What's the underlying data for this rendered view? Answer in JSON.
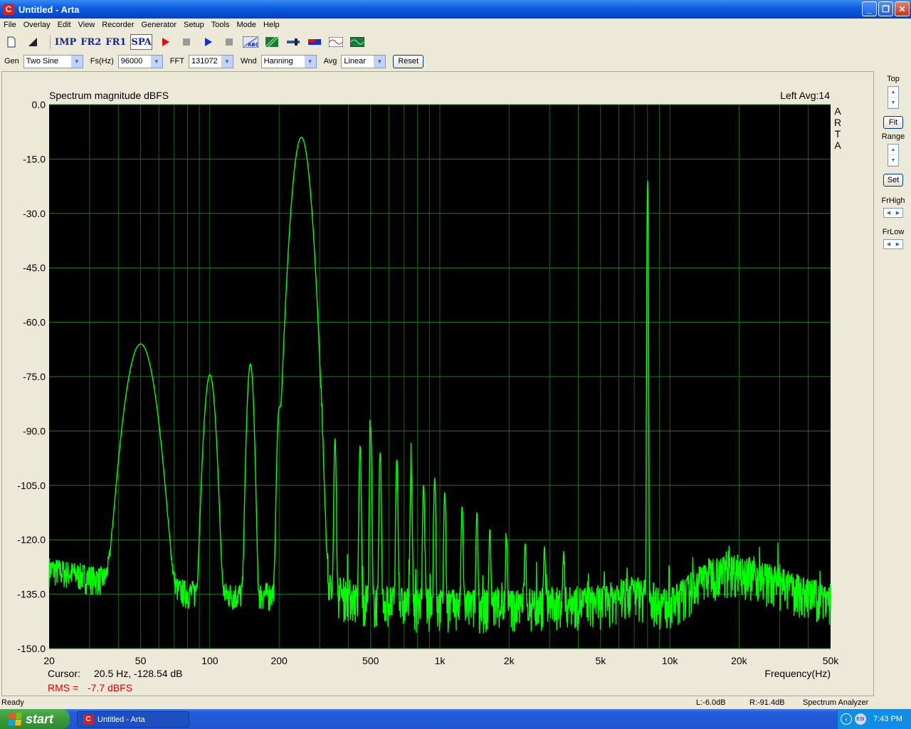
{
  "window": {
    "title": "Untitled - Arta",
    "minimize": "_",
    "maximize": "❐",
    "close": "✕"
  },
  "menu": [
    "File",
    "Overlay",
    "Edit",
    "View",
    "Recorder",
    "Generator",
    "Setup",
    "Tools",
    "Mode",
    "Help"
  ],
  "toolbar": {
    "imp": "IMP",
    "fr2": "FR2",
    "fr1": "FR1",
    "spa": "SPA",
    "abc": "ABC"
  },
  "params": {
    "gen_label": "Gen",
    "gen_value": "Two Sine",
    "fs_label": "Fs(Hz)",
    "fs_value": "96000",
    "fft_label": "FFT",
    "fft_value": "131072",
    "wnd_label": "Wnd",
    "wnd_value": "Hanning",
    "avg_label": "Avg",
    "avg_value": "Linear",
    "reset_label": "Reset"
  },
  "graph": {
    "title": "Spectrum magnitude dBFS",
    "channel_info": "Left  Avg:14",
    "vertical_brand": [
      "A",
      "R",
      "T",
      "A"
    ],
    "cursor_label": "Cursor:",
    "cursor_value": "20.5 Hz, -128.54 dB",
    "rms_label": "RMS =",
    "rms_value": "-7.7 dBFS",
    "rms_color": "#e00000",
    "trace_color": "#00ff00",
    "grid_color": "#1f7a1f",
    "background": "#000000"
  },
  "chart_data": {
    "type": "line",
    "title": "Spectrum magnitude dBFS",
    "xlabel": "Frequency(Hz)",
    "ylabel": "",
    "xscale": "log",
    "xlim": [
      20,
      50000
    ],
    "ylim": [
      -150,
      0
    ],
    "grid": true,
    "x_ticks": [
      20,
      50,
      100,
      200,
      500,
      1000,
      2000,
      5000,
      10000,
      20000,
      50000
    ],
    "x_tick_labels": [
      "20",
      "50",
      "100",
      "200",
      "500",
      "1k",
      "2k",
      "5k",
      "10k",
      "20k",
      "50k"
    ],
    "y_ticks": [
      0,
      -15,
      -30,
      -45,
      -60,
      -75,
      -90,
      -105,
      -120,
      -135,
      -150
    ],
    "y_tick_labels": [
      "0.0",
      "-15.0",
      "-30.0",
      "-45.0",
      "-60.0",
      "-75.0",
      "-90.0",
      "-105.0",
      "-120.0",
      "-135.0",
      "-150.0"
    ],
    "noise_floor_db": [
      [
        20,
        -127
      ],
      [
        50,
        -132
      ],
      [
        100,
        -134
      ],
      [
        200,
        -134
      ],
      [
        300,
        -135
      ],
      [
        500,
        -139
      ],
      [
        1000,
        -140
      ],
      [
        2000,
        -140
      ],
      [
        5000,
        -139
      ],
      [
        7000,
        -136
      ],
      [
        10000,
        -140
      ],
      [
        15000,
        -131
      ],
      [
        20000,
        -130
      ],
      [
        30000,
        -134
      ],
      [
        40000,
        -137
      ],
      [
        50000,
        -138
      ]
    ],
    "peaks": [
      {
        "f": 50,
        "db": -66,
        "width": 0.05
      },
      {
        "f": 100,
        "db": -74.5,
        "width": 0.02
      },
      {
        "f": 150,
        "db": -71.5,
        "width": 0.012
      },
      {
        "f": 200,
        "db": -85,
        "width": 0.008
      },
      {
        "f": 250,
        "db": -9,
        "width": 0.03
      },
      {
        "f": 350,
        "db": -92,
        "width": 0.004
      },
      {
        "f": 450,
        "db": -94,
        "width": 0.004
      },
      {
        "f": 500,
        "db": -89,
        "width": 0.004
      },
      {
        "f": 550,
        "db": -96,
        "width": 0.004
      },
      {
        "f": 650,
        "db": -98,
        "width": 0.004
      },
      {
        "f": 750,
        "db": -101,
        "width": 0.004
      },
      {
        "f": 850,
        "db": -105,
        "width": 0.004
      },
      {
        "f": 950,
        "db": -103,
        "width": 0.004
      },
      {
        "f": 1050,
        "db": -107,
        "width": 0.004
      },
      {
        "f": 1250,
        "db": -111,
        "width": 0.004
      },
      {
        "f": 1450,
        "db": -113,
        "width": 0.004
      },
      {
        "f": 1650,
        "db": -118,
        "width": 0.004
      },
      {
        "f": 1950,
        "db": -121,
        "width": 0.004
      },
      {
        "f": 2350,
        "db": -122,
        "width": 0.004
      },
      {
        "f": 2850,
        "db": -124,
        "width": 0.004
      },
      {
        "f": 3450,
        "db": -126,
        "width": 0.004
      },
      {
        "f": 8000,
        "db": -20.5,
        "width": 0.002
      }
    ]
  },
  "right_panel": {
    "top_label": "Top",
    "fit_label": "Fit",
    "range_label": "Range",
    "set_label": "Set",
    "frhigh_label": "FrHigh",
    "frlow_label": "FrLow"
  },
  "status": {
    "ready": "Ready",
    "left_level": "L:-6.0dB",
    "right_level": "R:-91.4dB",
    "mode": "Spectrum Analyzer"
  },
  "taskbar": {
    "start": "start",
    "task_item": "Untitled - Arta",
    "clock": "7:43 PM",
    "tray_icon": "ESI"
  }
}
